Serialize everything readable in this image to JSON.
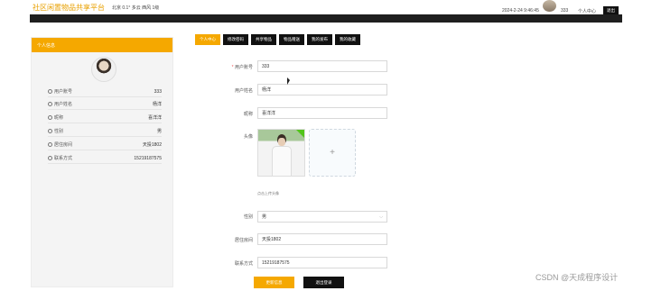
{
  "header": {
    "brand": "社区闲置物品共享平台",
    "weather": "北京  0.1°  多云  西风  1级",
    "datetime": "2024-2-24 9:46:45",
    "username": "333",
    "user_center": "个人中心",
    "exit_label": "退出"
  },
  "profile_card": {
    "title": "个人信息",
    "rows": [
      {
        "label": "用户账号",
        "value": "333"
      },
      {
        "label": "用户姓名",
        "value": "杨洋"
      },
      {
        "label": "昵称",
        "value": "喜洋洋"
      },
      {
        "label": "性别",
        "value": "男"
      },
      {
        "label": "居住房间",
        "value": "天投1802"
      },
      {
        "label": "联系方式",
        "value": "15219187575"
      }
    ]
  },
  "tabs": [
    {
      "label": "个人中心",
      "active": true
    },
    {
      "label": "修改密码",
      "active": false
    },
    {
      "label": "共享物品",
      "active": false
    },
    {
      "label": "物品赠送",
      "active": false
    },
    {
      "label": "我的发布",
      "active": false
    },
    {
      "label": "我的收藏",
      "active": false
    }
  ],
  "form": {
    "account_label": "用户账号",
    "account_value": "333",
    "name_label": "用户姓名",
    "name_value": "杨洋",
    "nickname_label": "昵称",
    "nickname_value": "喜洋洋",
    "avatar_label": "头像",
    "upload_hint": "点击上传头像",
    "gender_label": "性别",
    "gender_value": "男",
    "room_label": "居住房间",
    "room_value": "天投1802",
    "phone_label": "联系方式",
    "phone_value": "15219187575",
    "update_button": "更新信息",
    "logout_button": "退出登录"
  },
  "watermark": "CSDN @天成程序设计",
  "colors": {
    "accent": "#f5a800",
    "dark": "#111111"
  }
}
